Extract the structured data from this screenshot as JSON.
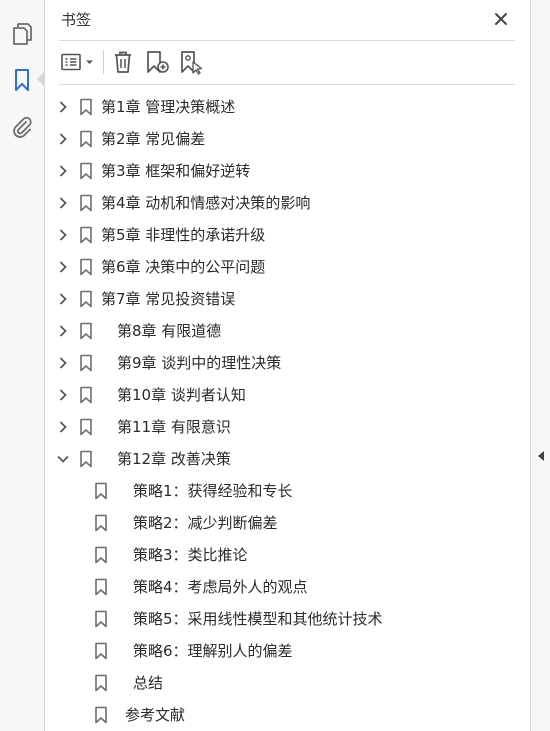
{
  "panel": {
    "title": "书签"
  },
  "rail": {
    "tools": [
      {
        "name": "pages-icon"
      },
      {
        "name": "bookmark-icon"
      },
      {
        "name": "attachment-icon"
      }
    ]
  },
  "toolbar": {
    "tools": [
      "options-menu-icon",
      "delete-bookmark-icon",
      "new-bookmark-icon",
      "bookmark-from-selection-icon"
    ]
  },
  "bookmarks": [
    {
      "label": "第1章  管理决策概述",
      "level": 0,
      "expandable": true,
      "expanded": false,
      "indent_label": false
    },
    {
      "label": "第2章  常见偏差",
      "level": 0,
      "expandable": true,
      "expanded": false,
      "indent_label": false
    },
    {
      "label": "第3章  框架和偏好逆转",
      "level": 0,
      "expandable": true,
      "expanded": false,
      "indent_label": false
    },
    {
      "label": "第4章  动机和情感对决策的影响",
      "level": 0,
      "expandable": true,
      "expanded": false,
      "indent_label": false
    },
    {
      "label": "第5章  非理性的承诺升级",
      "level": 0,
      "expandable": true,
      "expanded": false,
      "indent_label": false
    },
    {
      "label": "第6章  决策中的公平问题",
      "level": 0,
      "expandable": true,
      "expanded": false,
      "indent_label": false
    },
    {
      "label": "第7章  常见投资错误",
      "level": 0,
      "expandable": true,
      "expanded": false,
      "indent_label": false
    },
    {
      "label": "第8章  有限道德",
      "level": 0,
      "expandable": true,
      "expanded": false,
      "indent_label": true
    },
    {
      "label": "第9章  谈判中的理性决策",
      "level": 0,
      "expandable": true,
      "expanded": false,
      "indent_label": true
    },
    {
      "label": "第10章  谈判者认知",
      "level": 0,
      "expandable": true,
      "expanded": false,
      "indent_label": true
    },
    {
      "label": "第11章  有限意识",
      "level": 0,
      "expandable": true,
      "expanded": false,
      "indent_label": true
    },
    {
      "label": "第12章  改善决策",
      "level": 0,
      "expandable": true,
      "expanded": true,
      "indent_label": true
    },
    {
      "label": "策略1：获得经验和专长",
      "level": 1,
      "expandable": false,
      "expanded": false,
      "indent_label": true
    },
    {
      "label": "策略2：减少判断偏差",
      "level": 1,
      "expandable": false,
      "expanded": false,
      "indent_label": true
    },
    {
      "label": "策略3：类比推论",
      "level": 1,
      "expandable": false,
      "expanded": false,
      "indent_label": true
    },
    {
      "label": "策略4：考虑局外人的观点",
      "level": 1,
      "expandable": false,
      "expanded": false,
      "indent_label": true
    },
    {
      "label": "策略5：采用线性模型和其他统计技术",
      "level": 1,
      "expandable": false,
      "expanded": false,
      "indent_label": true
    },
    {
      "label": "策略6：理解别人的偏差",
      "level": 1,
      "expandable": false,
      "expanded": false,
      "indent_label": true
    },
    {
      "label": "总结",
      "level": 1,
      "expandable": false,
      "expanded": false,
      "indent_label": true
    },
    {
      "label": "参考文献",
      "level": 1,
      "expandable": false,
      "expanded": false,
      "indent_label": false
    }
  ],
  "colors": {
    "icon": "#6e6e6e",
    "accent": "#2c6fd6",
    "text": "#2b2b2b"
  }
}
